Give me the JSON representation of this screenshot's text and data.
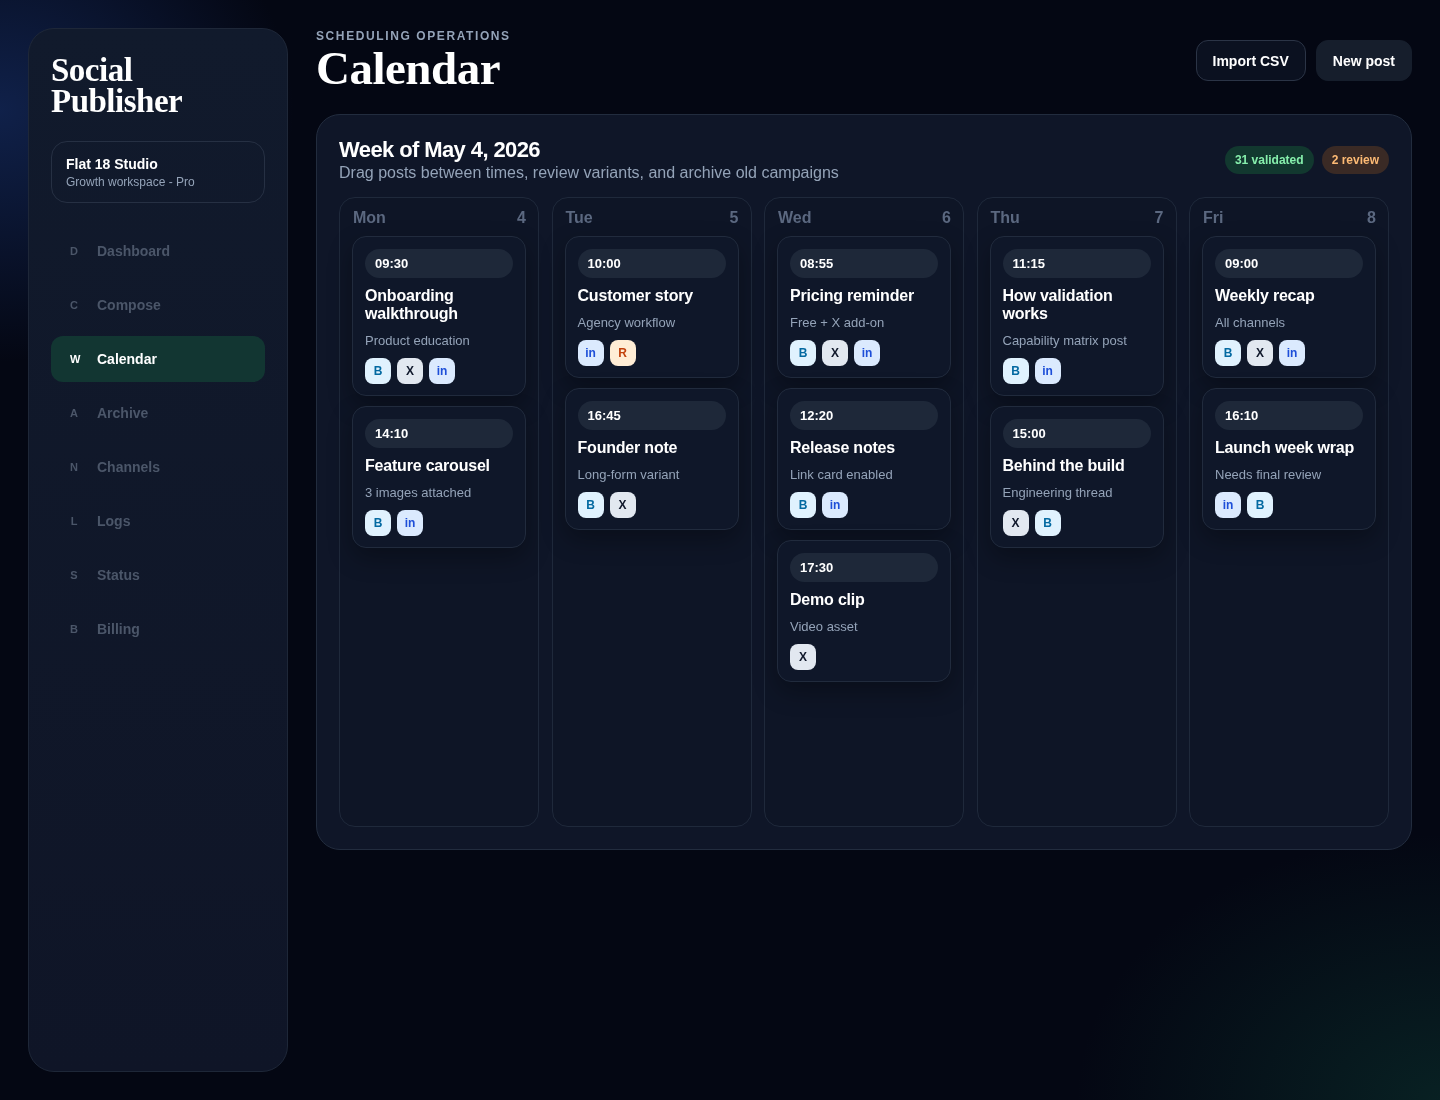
{
  "sidebar": {
    "brand": "Social Publisher",
    "workspace": {
      "name": "Flat 18 Studio",
      "plan": "Growth workspace - Pro"
    },
    "items": [
      {
        "key": "D",
        "label": "Dashboard",
        "selected": false
      },
      {
        "key": "C",
        "label": "Compose",
        "selected": false
      },
      {
        "key": "W",
        "label": "Calendar",
        "selected": true
      },
      {
        "key": "A",
        "label": "Archive",
        "selected": false
      },
      {
        "key": "N",
        "label": "Channels",
        "selected": false
      },
      {
        "key": "L",
        "label": "Logs",
        "selected": false
      },
      {
        "key": "S",
        "label": "Status",
        "selected": false
      },
      {
        "key": "B",
        "label": "Billing",
        "selected": false
      }
    ]
  },
  "header": {
    "eyebrow": "SCHEDULING OPERATIONS",
    "title": "Calendar",
    "buttons": [
      {
        "label": "Import CSV",
        "kind": "outline"
      },
      {
        "label": "New post",
        "kind": "filled"
      }
    ]
  },
  "week": {
    "title": "Week of May 4, 2026",
    "subtitle": "Drag posts between times, review variants, and archive old campaigns",
    "badges": [
      {
        "label": "31 validated",
        "kind": "success"
      },
      {
        "label": "2 review",
        "kind": "warning"
      }
    ],
    "days": [
      {
        "name": "Mon",
        "date": "4",
        "posts": [
          {
            "time": "09:30",
            "title": "Onboarding walkthrough",
            "note": "Product education",
            "channels": [
              {
                "label": "B",
                "kind": "sky"
              },
              {
                "label": "X",
                "kind": "slate"
              },
              {
                "label": "in",
                "kind": "indigo"
              }
            ]
          },
          {
            "time": "14:10",
            "title": "Feature carousel",
            "note": "3 images attached",
            "channels": [
              {
                "label": "B",
                "kind": "sky"
              },
              {
                "label": "in",
                "kind": "indigo"
              }
            ]
          }
        ]
      },
      {
        "name": "Tue",
        "date": "5",
        "posts": [
          {
            "time": "10:00",
            "title": "Customer story",
            "note": "Agency workflow",
            "channels": [
              {
                "label": "in",
                "kind": "indigo"
              },
              {
                "label": "R",
                "kind": "amber"
              }
            ]
          },
          {
            "time": "16:45",
            "title": "Founder note",
            "note": "Long-form variant",
            "channels": [
              {
                "label": "B",
                "kind": "sky"
              },
              {
                "label": "X",
                "kind": "slate"
              }
            ]
          }
        ]
      },
      {
        "name": "Wed",
        "date": "6",
        "posts": [
          {
            "time": "08:55",
            "title": "Pricing reminder",
            "note": "Free + X add-on",
            "channels": [
              {
                "label": "B",
                "kind": "sky"
              },
              {
                "label": "X",
                "kind": "slate"
              },
              {
                "label": "in",
                "kind": "indigo"
              }
            ]
          },
          {
            "time": "12:20",
            "title": "Release notes",
            "note": "Link card enabled",
            "channels": [
              {
                "label": "B",
                "kind": "sky"
              },
              {
                "label": "in",
                "kind": "indigo"
              }
            ]
          },
          {
            "time": "17:30",
            "title": "Demo clip",
            "note": "Video asset",
            "channels": [
              {
                "label": "X",
                "kind": "slate"
              }
            ]
          }
        ]
      },
      {
        "name": "Thu",
        "date": "7",
        "posts": [
          {
            "time": "11:15",
            "title": "How validation works",
            "note": "Capability matrix post",
            "channels": [
              {
                "label": "B",
                "kind": "sky"
              },
              {
                "label": "in",
                "kind": "indigo"
              }
            ]
          },
          {
            "time": "15:00",
            "title": "Behind the build",
            "note": "Engineering thread",
            "channels": [
              {
                "label": "X",
                "kind": "slate"
              },
              {
                "label": "B",
                "kind": "sky"
              }
            ]
          }
        ]
      },
      {
        "name": "Fri",
        "date": "8",
        "posts": [
          {
            "time": "09:00",
            "title": "Weekly recap",
            "note": "All channels",
            "channels": [
              {
                "label": "B",
                "kind": "sky"
              },
              {
                "label": "X",
                "kind": "slate"
              },
              {
                "label": "in",
                "kind": "indigo"
              }
            ]
          },
          {
            "time": "16:10",
            "title": "Launch week wrap",
            "note": "Needs final review",
            "channels": [
              {
                "label": "in",
                "kind": "indigo"
              },
              {
                "label": "B",
                "kind": "sky"
              }
            ]
          }
        ]
      }
    ]
  }
}
